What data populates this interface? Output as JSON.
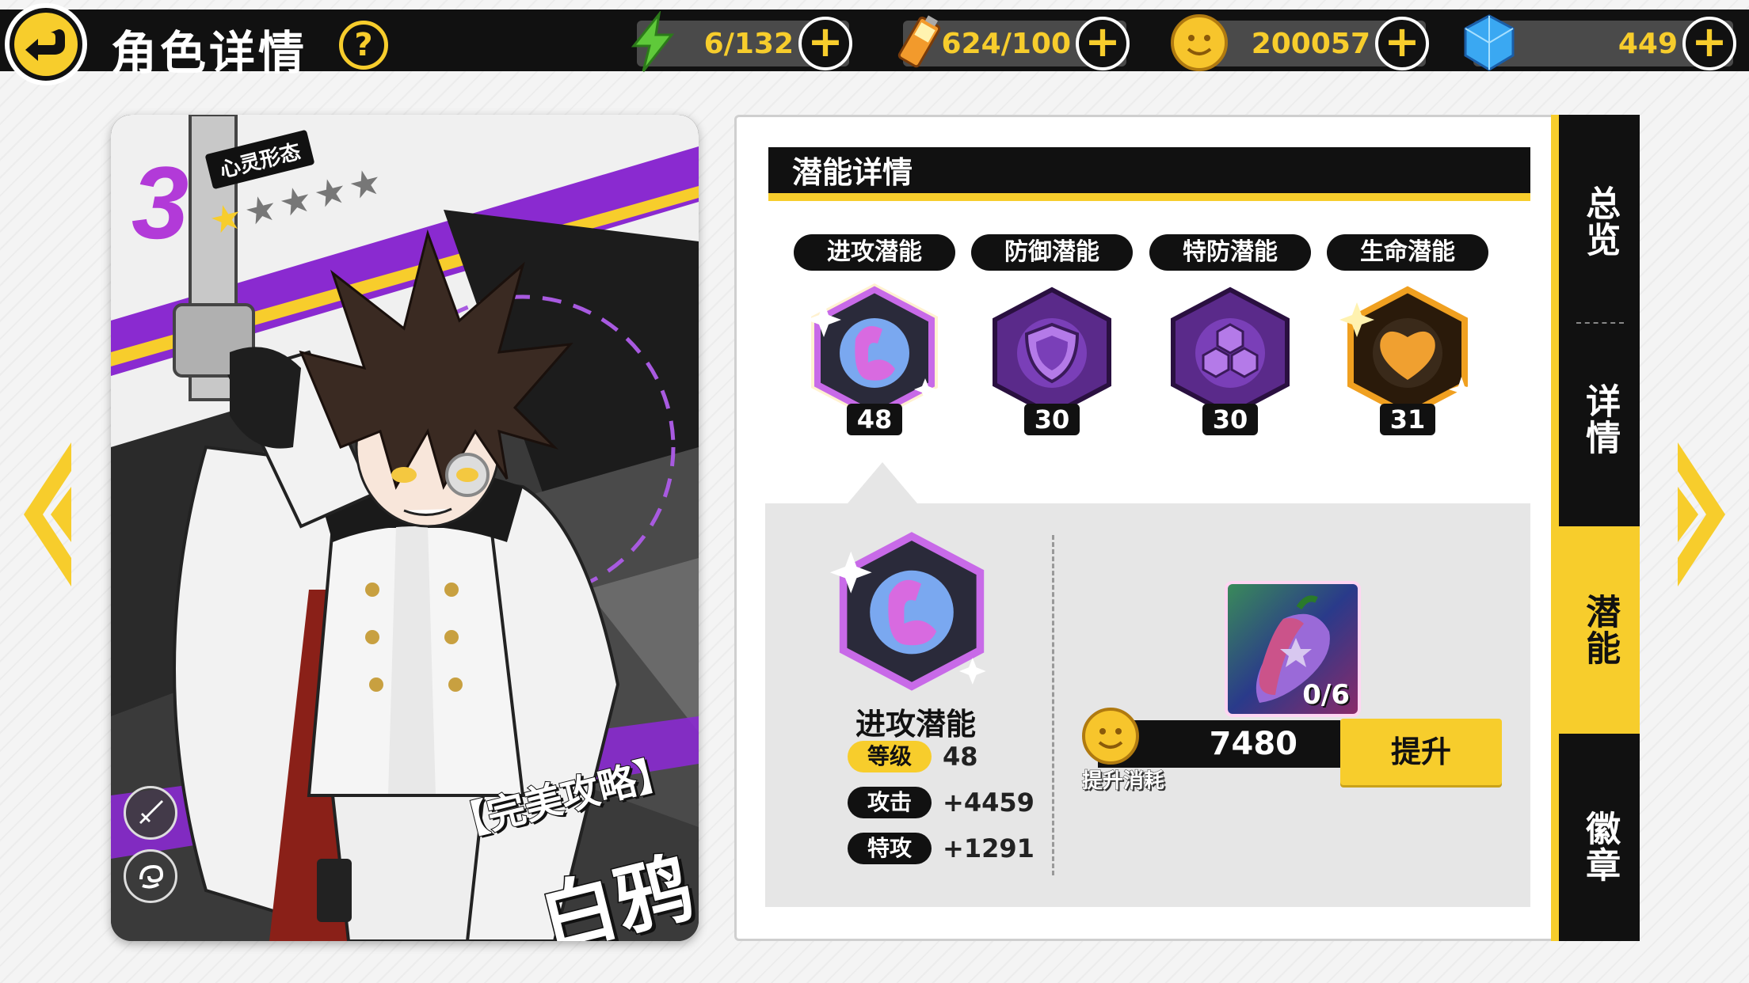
{
  "header": {
    "title": "角色详情",
    "help_label": "?"
  },
  "resources": [
    {
      "name": "energy",
      "icon": "lightning-icon",
      "value": "6/132"
    },
    {
      "name": "battery",
      "icon": "battery-icon",
      "value": "624/100"
    },
    {
      "name": "coin",
      "icon": "coin-icon",
      "value": "200057"
    },
    {
      "name": "diamond",
      "icon": "gem-icon",
      "value": "449"
    }
  ],
  "character": {
    "form_number": "3",
    "form_label": "心灵形态",
    "stars_filled": 1,
    "stars_total": 5,
    "subtitle": "【完美攻略】",
    "name": "白鸦"
  },
  "panel": {
    "title": "潜能详情",
    "potentials": [
      {
        "label": "进攻潜能",
        "level": "48",
        "color": "#7a3fb8",
        "icon": "arm-icon"
      },
      {
        "label": "防御潜能",
        "level": "30",
        "color": "#7a3fb8",
        "icon": "shield-icon"
      },
      {
        "label": "特防潜能",
        "level": "30",
        "color": "#7a3fb8",
        "icon": "hexagon-icon"
      },
      {
        "label": "生命潜能",
        "level": "31",
        "color": "#e08a1a",
        "icon": "heart-icon"
      }
    ],
    "selected": {
      "name": "进攻潜能",
      "stats": [
        {
          "label": "等级",
          "value": "48"
        },
        {
          "label": "攻击",
          "value": "+4459"
        },
        {
          "label": "特攻",
          "value": "+1291"
        }
      ]
    },
    "material_count": "0/6",
    "cost_value": "7480",
    "cost_label": "提升消耗",
    "upgrade_label": "提升"
  },
  "sidenav": {
    "items": [
      {
        "label": "总览"
      },
      {
        "label": "详情"
      },
      {
        "label": "潜能"
      },
      {
        "label": "徽章"
      }
    ],
    "active": "潜能"
  },
  "colors": {
    "accent": "#f7cd2c",
    "dark": "#111111",
    "purple": "#b23ad8"
  }
}
